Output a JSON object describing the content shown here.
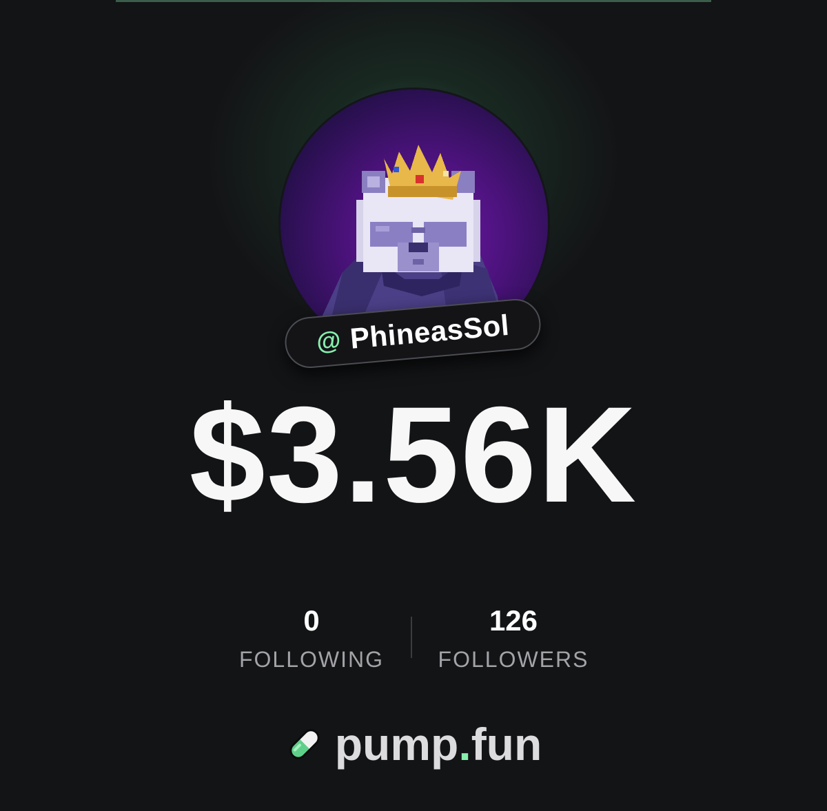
{
  "profile": {
    "at_symbol": "@",
    "handle": "PhineasSol",
    "avatar_icon": "pixel-panda-king-avatar"
  },
  "balance": "$3.56K",
  "stats": {
    "following": {
      "value": "0",
      "label": "FOLLOWING"
    },
    "followers": {
      "value": "126",
      "label": "FOLLOWERS"
    }
  },
  "brand": {
    "name_main": "pump",
    "name_dot": ".",
    "name_tld": "fun",
    "logo_icon": "pill-icon"
  },
  "colors": {
    "background": "#131416",
    "accent_green": "#86efac",
    "avatar_purple": "#4a127a"
  }
}
